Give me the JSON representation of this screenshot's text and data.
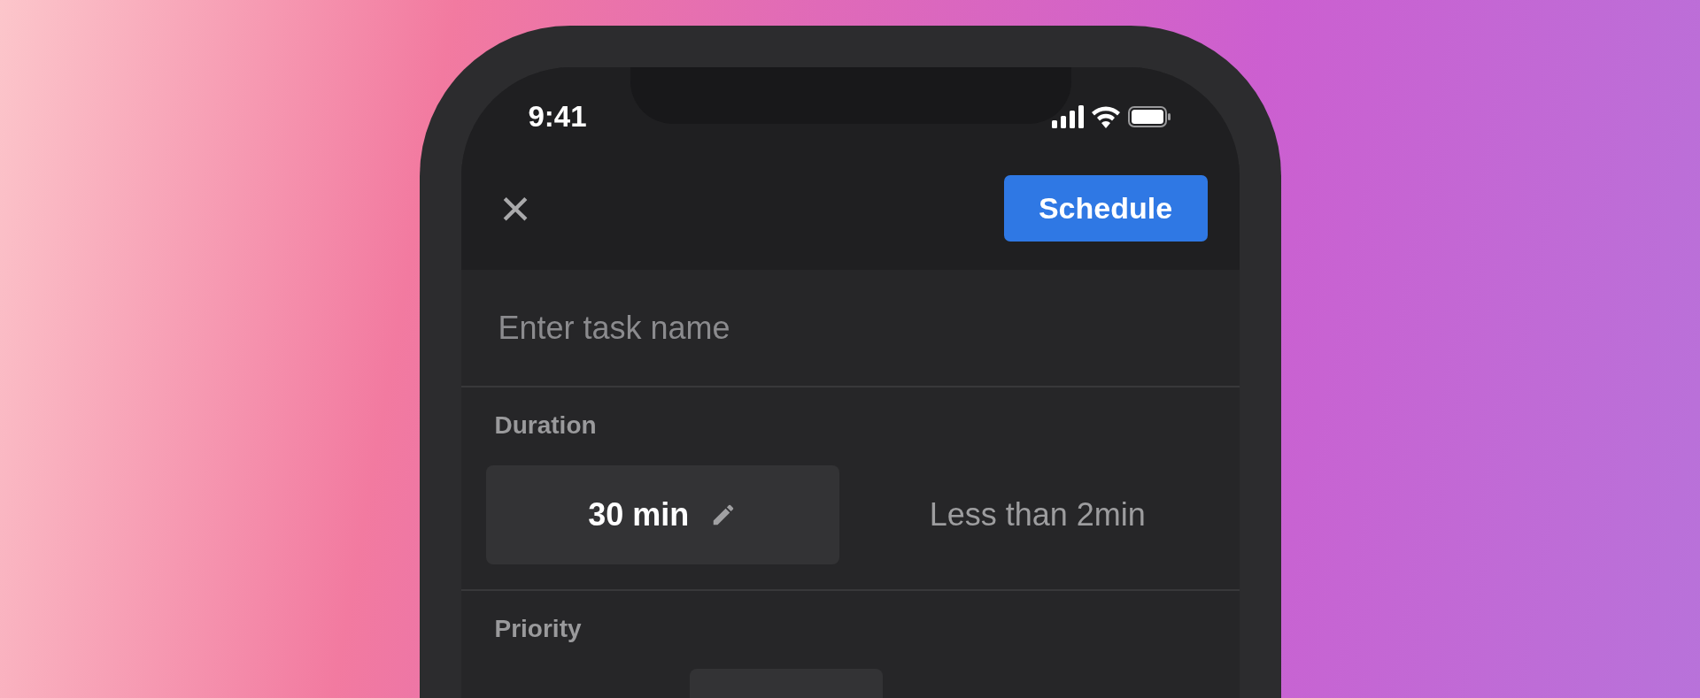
{
  "status_bar": {
    "time": "9:41"
  },
  "header": {
    "close": "×",
    "action": "Schedule"
  },
  "task_name": {
    "placeholder": "Enter task name"
  },
  "duration": {
    "label": "Duration",
    "options": [
      {
        "text": "30 min",
        "editable": true,
        "selected": true
      },
      {
        "text": "Less than 2min",
        "editable": false,
        "selected": false
      }
    ]
  },
  "priority": {
    "label": "Priority",
    "options": [
      {
        "selected": true
      }
    ]
  }
}
